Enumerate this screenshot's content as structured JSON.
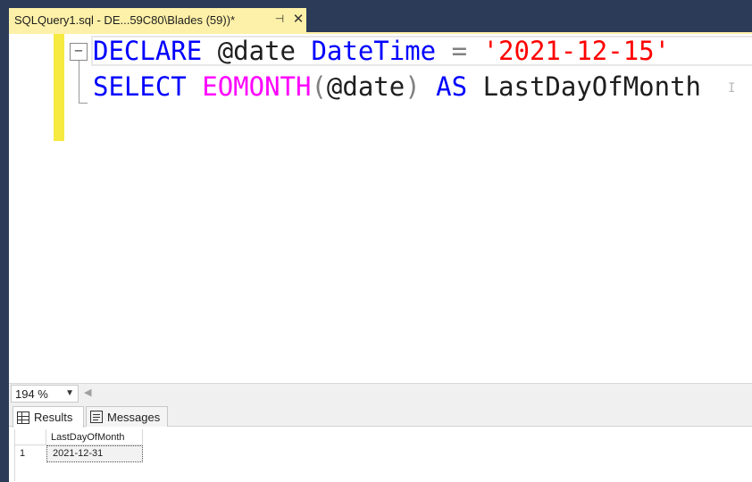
{
  "tab": {
    "title": "SQLQuery1.sql - DE...59C80\\Blades (59))*",
    "pin_glyph": "⊣",
    "close_glyph": "✕"
  },
  "editor": {
    "collapse_glyph": "−",
    "line1": {
      "kw1": "DECLARE",
      "var": "@date",
      "type": "DateTime",
      "op": "=",
      "str": "'2021-12-15'"
    },
    "line2": {
      "kw1": "SELECT",
      "fn": "EOMONTH",
      "lparen": "(",
      "arg": "@date",
      "rparen": ")",
      "kw2": "AS",
      "alias": "LastDayOfMonth"
    }
  },
  "zoom": {
    "value": "194 %"
  },
  "results": {
    "tabs": [
      {
        "label": "Results"
      },
      {
        "label": "Messages"
      }
    ],
    "grid": {
      "columns": [
        "LastDayOfMonth"
      ],
      "rows": [
        {
          "rownum": "1",
          "cells": [
            "2021-12-31"
          ]
        }
      ]
    }
  },
  "colors": {
    "keyword": "#0000ff",
    "function": "#ff00ff",
    "string": "#ff0000",
    "operator": "#808080",
    "tab_active": "#fdf0a8",
    "chrome": "#2b3b58"
  }
}
